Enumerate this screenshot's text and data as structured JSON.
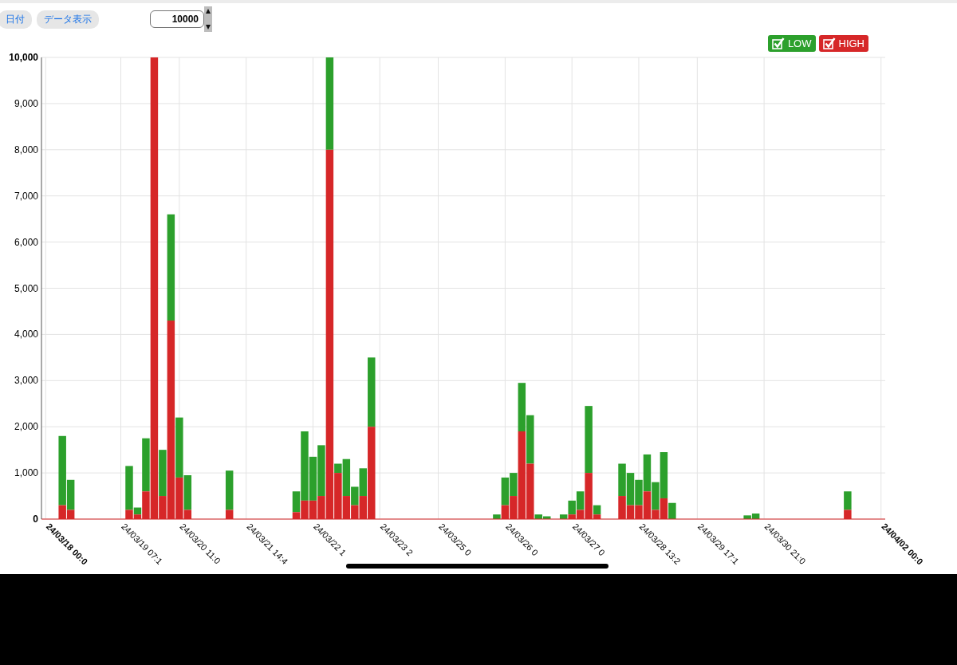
{
  "toolbar": {
    "buttons": [
      {
        "label": "日付"
      },
      {
        "label": "データ表示"
      }
    ],
    "max_field": {
      "value": "10000"
    }
  },
  "legend": [
    {
      "checked": true
    },
    {
      "checked": true
    }
  ],
  "chart": {
    "chart_data": {
      "type": "bar",
      "stacked": true,
      "grid": true,
      "ylim": [
        0,
        10000
      ],
      "yticks": [
        {
          "value": 0,
          "label": "0"
        },
        {
          "value": 1000,
          "label": "1,000"
        },
        {
          "value": 2000,
          "label": "2,000"
        },
        {
          "value": 3000,
          "label": "3,000"
        },
        {
          "value": 4000,
          "label": "4,000"
        },
        {
          "value": 5000,
          "label": "5,000"
        },
        {
          "value": 6000,
          "label": "6,000"
        },
        {
          "value": 7000,
          "label": "7,000"
        },
        {
          "value": 8000,
          "label": "8,000"
        },
        {
          "value": 9000,
          "label": "9,000"
        },
        {
          "value": 10000,
          "label": "10,000"
        }
      ],
      "categories": [
        "24/03/18 00:0",
        null,
        null,
        null,
        null,
        null,
        null,
        null,
        null,
        "24/03/19 07:1",
        null,
        null,
        null,
        null,
        null,
        null,
        "24/03/20 11:0",
        null,
        null,
        null,
        null,
        null,
        null,
        null,
        "24/03/21 14:4",
        null,
        null,
        null,
        null,
        null,
        null,
        null,
        "24/03/22 1",
        null,
        null,
        null,
        null,
        null,
        null,
        null,
        "24/03/23 2",
        null,
        null,
        null,
        null,
        null,
        null,
        "24/03/25 0",
        null,
        null,
        null,
        null,
        null,
        null,
        null,
        "24/03/26 0",
        null,
        null,
        null,
        null,
        null,
        null,
        null,
        "24/03/27 0",
        null,
        null,
        null,
        null,
        null,
        null,
        null,
        "24/03/28 13:2",
        null,
        null,
        null,
        null,
        null,
        null,
        "24/03/29 17:1",
        null,
        null,
        null,
        null,
        null,
        null,
        null,
        "24/03/30 21:0",
        null,
        null,
        null,
        null,
        null,
        null,
        null,
        null,
        null,
        null,
        null,
        null,
        null,
        "24/04/02 00:0"
      ],
      "series": [
        {
          "name": "LOW",
          "color": "#2ca02c",
          "values": [
            0,
            0,
            1500,
            650,
            0,
            0,
            0,
            0,
            0,
            0,
            950,
            150,
            1150,
            0,
            1000,
            2300,
            1300,
            750,
            0,
            0,
            0,
            0,
            850,
            0,
            0,
            0,
            0,
            0,
            0,
            0,
            450,
            1500,
            950,
            1100,
            2000,
            200,
            800,
            400,
            600,
            1500,
            0,
            0,
            0,
            0,
            0,
            0,
            0,
            0,
            0,
            0,
            0,
            0,
            0,
            0,
            100,
            600,
            500,
            1050,
            1050,
            100,
            60,
            0,
            100,
            300,
            400,
            1450,
            200,
            0,
            0,
            700,
            700,
            550,
            800,
            600,
            1000,
            350,
            0,
            0,
            0,
            0,
            0,
            0,
            0,
            0,
            80,
            120,
            0,
            0,
            0,
            0,
            0,
            0,
            0,
            0,
            0,
            0,
            400,
            0,
            0,
            0,
            0
          ]
        },
        {
          "name": "HIGH",
          "color": "#d62728",
          "values": [
            0,
            0,
            300,
            200,
            0,
            0,
            0,
            0,
            0,
            0,
            200,
            100,
            600,
            10000,
            500,
            4300,
            900,
            200,
            0,
            0,
            0,
            0,
            200,
            0,
            0,
            0,
            0,
            0,
            0,
            0,
            150,
            400,
            400,
            500,
            8000,
            1000,
            500,
            300,
            500,
            2000,
            0,
            0,
            0,
            0,
            0,
            0,
            0,
            0,
            0,
            0,
            0,
            0,
            0,
            0,
            0,
            300,
            500,
            1900,
            1200,
            0,
            0,
            0,
            0,
            100,
            200,
            1000,
            100,
            0,
            0,
            500,
            300,
            300,
            600,
            200,
            450,
            0,
            0,
            0,
            0,
            0,
            0,
            0,
            0,
            0,
            0,
            0,
            0,
            0,
            0,
            0,
            0,
            0,
            0,
            0,
            0,
            0,
            200,
            0,
            0,
            0,
            0
          ]
        }
      ]
    }
  }
}
